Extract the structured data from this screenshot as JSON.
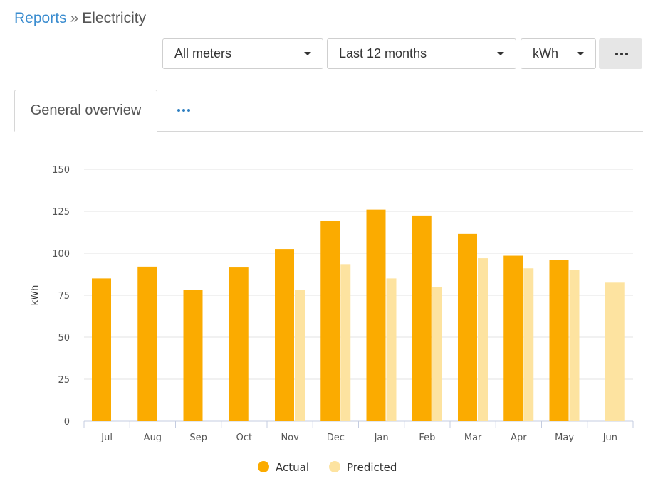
{
  "breadcrumb": {
    "root": "Reports",
    "separator": "»",
    "current": "Electricity"
  },
  "filters": {
    "meters": "All meters",
    "period": "Last 12 months",
    "unit": "kWh"
  },
  "tabs": [
    {
      "label": "General overview",
      "active": true
    }
  ],
  "colors": {
    "actual": "#fbab00",
    "predicted": "#fde3a0",
    "link": "#3a8ccf"
  },
  "chart_data": {
    "type": "bar",
    "ylabel": "kWh",
    "ylim": [
      0,
      150
    ],
    "yticks": [
      0,
      25,
      50,
      75,
      100,
      125,
      150
    ],
    "grid": true,
    "legend": "bottom-center",
    "categories": [
      "Jul",
      "Aug",
      "Sep",
      "Oct",
      "Nov",
      "Dec",
      "Jan",
      "Feb",
      "Mar",
      "Apr",
      "May",
      "Jun"
    ],
    "series": [
      {
        "name": "Actual",
        "values": [
          85,
          92,
          78,
          91.5,
          102.5,
          119.5,
          126,
          122.5,
          111.5,
          98.5,
          96,
          null
        ]
      },
      {
        "name": "Predicted",
        "values": [
          null,
          null,
          null,
          null,
          78,
          93.5,
          85,
          80,
          97,
          91,
          90,
          82.5
        ]
      }
    ]
  }
}
